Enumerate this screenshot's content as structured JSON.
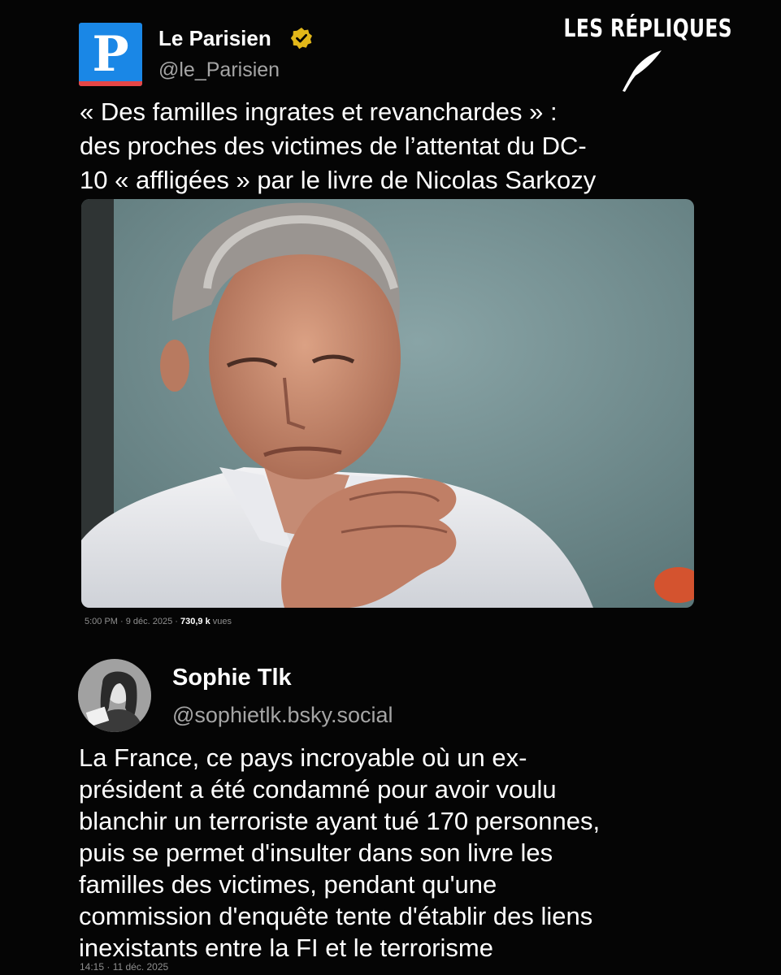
{
  "brand": {
    "label": "LES RÉPLIQUES"
  },
  "tweet1": {
    "avatar_letter": "P",
    "name": "Le Parisien",
    "handle": "@le_Parisien",
    "text_lines": [
      "« Des familles ingrates et revanchardes » :",
      "des proches des victimes de l’attentat du DC-",
      "10 « affligées » par le livre de Nicolas Sarkozy"
    ],
    "meta_time": "5:00 PM · 9 déc. 2025 · ",
    "meta_views": "730,9 k",
    "meta_views_label": " vues"
  },
  "tweet2": {
    "name": "Sophie Tlk",
    "handle": "@sophietlk.bsky.social",
    "text_lines": [
      "La France, ce pays incroyable où un ex-",
      "président a été condamné pour avoir voulu",
      "blanchir un terroriste ayant tué 170 personnes,",
      "puis se permet d'insulter dans son livre les",
      "familles des victimes, pendant qu'une",
      "commission d'enquête tente d'établir des liens",
      "inexistants entre la FI et le terrorisme"
    ],
    "meta_time": "14:15 · 11 déc. 2025"
  },
  "icons": {
    "verified": "verified-badge-icon",
    "quill": "quill-icon"
  },
  "colors": {
    "background": "#050505",
    "verified_gold": "#e2b719",
    "parisien_blue": "#1a87e6",
    "parisien_red": "#e54646",
    "muted_text": "#a5a5a5"
  }
}
